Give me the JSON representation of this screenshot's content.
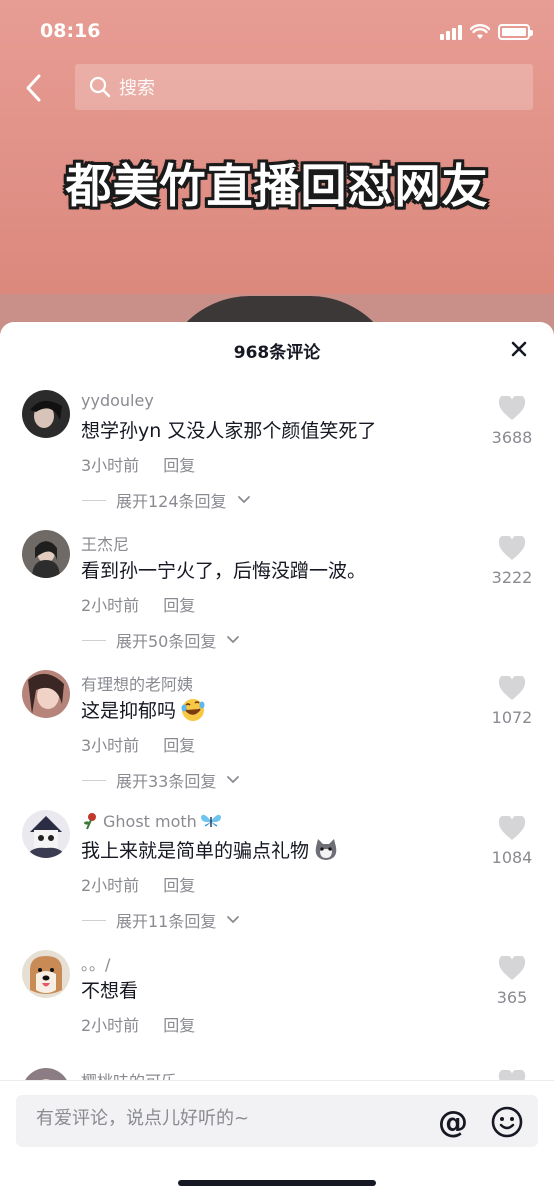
{
  "status_bar": {
    "time": "08:16"
  },
  "header": {
    "search_placeholder": "搜索"
  },
  "video": {
    "title_overlay": "都美竹直播回怼网友"
  },
  "comments_panel": {
    "count_label": "968条评论",
    "comments": [
      {
        "username": "yydouley",
        "text": "想学孙yn 又没人家那个颜值笑死了",
        "time": "3小时前",
        "reply_label": "回复",
        "expand_label": "展开124条回复",
        "likes": "3688",
        "avatar_color": "#2b2b2b"
      },
      {
        "username": "王杰尼",
        "text": "看到孙一宁火了，后悔没蹭一波。",
        "time": "2小时前",
        "reply_label": "回复",
        "expand_label": "展开50条回复",
        "likes": "3222",
        "avatar_color": "#6f6a66"
      },
      {
        "username": "有理想的老阿姨",
        "text": "这是抑郁吗",
        "emoji": "laughing-crying-emoji",
        "time": "3小时前",
        "reply_label": "回复",
        "expand_label": "展开33条回复",
        "likes": "1072",
        "avatar_color": "#b6847a"
      },
      {
        "username": "Ghost moth",
        "username_prefix_icon": "flower-icon",
        "username_suffix_icon": "butterfly-icon",
        "text": "我上来就是简单的骗点礼物",
        "emoji": "cat-emoji",
        "time": "2小时前",
        "reply_label": "回复",
        "expand_label": "展开11条回复",
        "likes": "1084",
        "avatar_color": "#3b3c52"
      },
      {
        "username": "。。/",
        "text": "不想看",
        "time": "2小时前",
        "reply_label": "回复",
        "likes": "365",
        "avatar_color": "#c98b55"
      },
      {
        "username": "樱桃味的可乐",
        "avatar_color": "#8c7d84"
      }
    ]
  },
  "input": {
    "placeholder": "有爱评论，说点儿好听的~",
    "at_label": "@"
  },
  "colors": {
    "text_primary": "#161823",
    "text_secondary": "#8a8b91",
    "video_bg": "#e79d94"
  }
}
